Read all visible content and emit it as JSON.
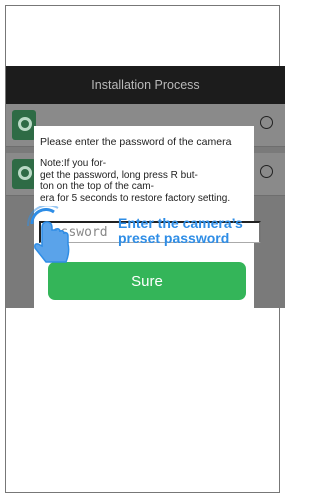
{
  "app": {
    "title": "Installation Process",
    "rows": [
      {
        "id": "row1"
      },
      {
        "id": "row2"
      }
    ]
  },
  "dialog": {
    "prompt": "Please enter the password of the camera",
    "note": "Note:If you for-\nget the password, long press R but-\nton on the top of the cam-\nera for 5 seconds to restore factory setting.",
    "password_placeholder": "Password",
    "sure_label": "Sure"
  },
  "hint": {
    "line1": "Enter the camera’s",
    "line2": "preset password"
  },
  "colors": {
    "accent": "#34b559",
    "hint": "#2e8de6",
    "appbar": "#1c1c1c"
  }
}
